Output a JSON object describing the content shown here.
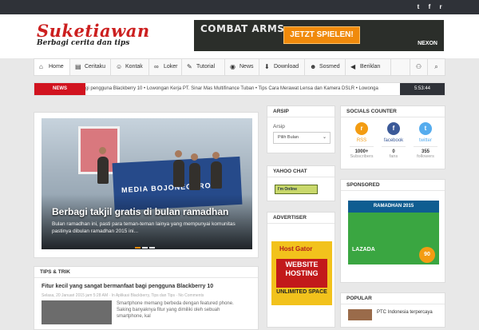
{
  "site": {
    "title": "Suketiawan",
    "tagline": "Berbagi cerita dan tips"
  },
  "topbar": {
    "icons": [
      "twitter-icon",
      "facebook-icon",
      "rss-icon"
    ],
    "glyphs": [
      "t",
      "f",
      "r"
    ]
  },
  "ad_banner": {
    "game": "COMBAT ARMS",
    "cta": "JETZT SPIELEN!",
    "brand": "NEXON"
  },
  "nav": {
    "items": [
      {
        "label": "Home",
        "icon": "home-icon",
        "glyph": "⌂"
      },
      {
        "label": "Ceritaku",
        "icon": "book-icon",
        "glyph": "▤"
      },
      {
        "label": "Kontak",
        "icon": "users-icon",
        "glyph": "☺"
      },
      {
        "label": "Loker",
        "icon": "link-icon",
        "glyph": "∞"
      },
      {
        "label": "Tutorial",
        "icon": "pencil-icon",
        "glyph": "✎"
      },
      {
        "label": "News",
        "icon": "signal-icon",
        "glyph": "◉"
      },
      {
        "label": "Download",
        "icon": "download-icon",
        "glyph": "⬇"
      },
      {
        "label": "Sosmed",
        "icon": "smile-icon",
        "glyph": "☻"
      },
      {
        "label": "Beriklan",
        "icon": "megaphone-icon",
        "glyph": "◀"
      }
    ],
    "right_icons": [
      "user-icon",
      "search-icon"
    ],
    "right_glyphs": [
      "⚇",
      "⌕"
    ]
  },
  "ticker": {
    "label": "NEWS",
    "items": "gi pengguna Blackberry 10   •  Lowongan Kerja PT. Sinar Mas Multifinance Tuban   •  Tips Cara Merawat Lensa dan Kamera DSLR   •  Lowonga",
    "time": "5:53:44"
  },
  "slider": {
    "caption": "Berbagi takjil gratis di bulan ramadhan",
    "description": "Bulan ramadhan ini, pasti para teman-teman lainya yang mempunyai komunitas pastinya dibulan ramadhan 2015 ini...",
    "banner_text": "MEDIA BOJONEGORO"
  },
  "tips": {
    "title": "TIPS & TRIK",
    "post_title": "Fitur kecil yang sangat bermanfaat bagi pengguna Blackberry 10",
    "meta": "Selasa, 20 Januari 2015 jam 5:28 AM · In Aplikasi Blackberry, Tips dan Tips · No Comments",
    "excerpt": "Smartphone memang berbeda dengan featured phone. Saking banyaknya fitur yang dimiliki oleh sebuah smartphone, kal"
  },
  "arsip": {
    "title": "ARSIP",
    "label": "Arsip",
    "select": "Pilih Bulan"
  },
  "yahoo": {
    "title": "YAHOO CHAT",
    "status": "I'm Online"
  },
  "advertiser": {
    "title": "ADVERTISER",
    "l1": "Host Gator",
    "l2": "WEBSITE HOSTING",
    "l3": "UNLIMITED SPACE"
  },
  "socials": {
    "title": "SOCIALS COUNTER",
    "items": [
      {
        "name": "RSS",
        "count": "1000+",
        "unit": "Subscribers",
        "color": "#f39c12",
        "icon": "rss-icon",
        "glyph": "r"
      },
      {
        "name": "facebook",
        "count": "0",
        "unit": "fans",
        "color": "#3b5998",
        "icon": "facebook-icon",
        "glyph": "f"
      },
      {
        "name": "twitter",
        "count": "355",
        "unit": "followers",
        "color": "#55acee",
        "icon": "twitter-icon",
        "glyph": "t"
      }
    ]
  },
  "sponsored": {
    "title": "SPONSORED",
    "header": "RAMADHAN 2015",
    "brand": "LAZADA",
    "badge": "90"
  },
  "popular": {
    "title": "POPULAR",
    "first": "PTC Indonesia terpercaya"
  }
}
